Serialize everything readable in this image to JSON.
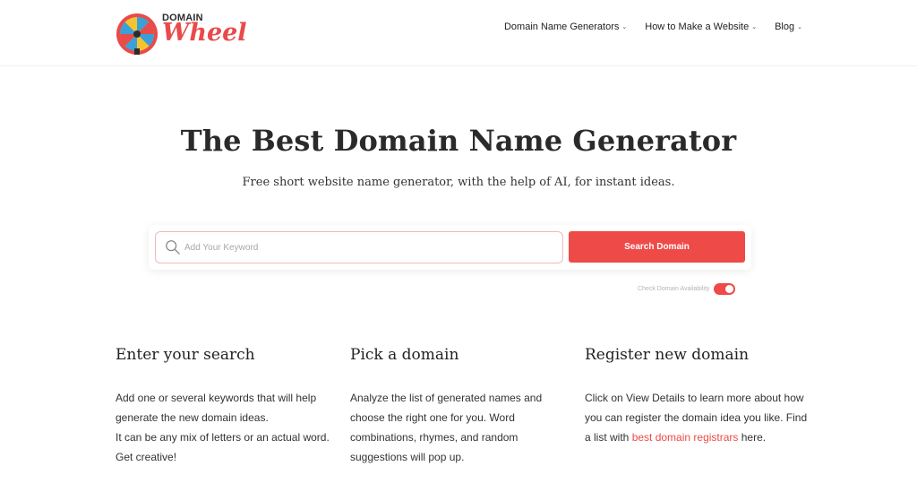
{
  "brand": {
    "top_text": "DOMAIN",
    "main_text": "Wheel"
  },
  "nav": {
    "items": [
      {
        "label": "Domain Name Generators"
      },
      {
        "label": "How to Make a Website"
      },
      {
        "label": "Blog"
      }
    ]
  },
  "hero": {
    "title": "The Best Domain Name Generator",
    "subtitle": "Free short website name generator, with the help of AI, for instant ideas."
  },
  "search": {
    "placeholder": "Add Your Keyword",
    "button_label": "Search Domain",
    "check_label": "Check Domain Availability",
    "check_enabled": true
  },
  "steps": [
    {
      "title": "Enter your search",
      "lines": [
        "Add one or several keywords that will help generate the new domain ideas.",
        "It can be any mix of letters or an actual word. Get creative!"
      ]
    },
    {
      "title": "Pick a domain",
      "text": "Analyze the list of generated names and choose the right one for you. Word combinations, rhymes, and random suggestions will pop up."
    },
    {
      "title": "Register new domain",
      "text_before": "Click on View Details to learn more about how you can register the domain idea you like. Find a list with ",
      "link": "best domain registrars",
      "text_after": " here."
    }
  ],
  "colors": {
    "accent": "#ee4a48",
    "text": "#2b2b2b"
  }
}
